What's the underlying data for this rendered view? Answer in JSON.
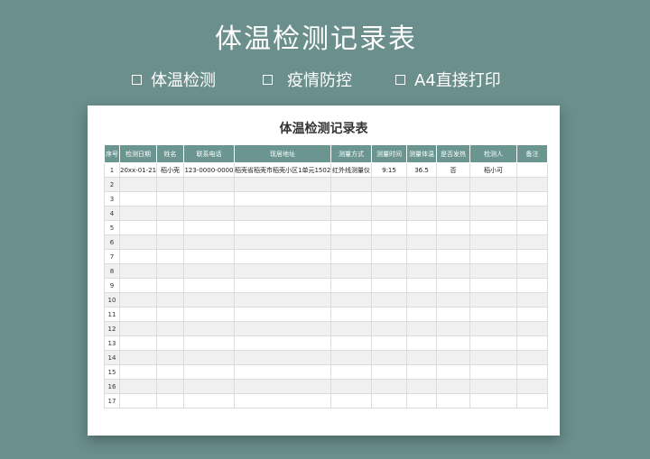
{
  "hero": {
    "title": "体温检测记录表",
    "features": [
      {
        "icon": "checkbox-icon",
        "label": "体温检测"
      },
      {
        "icon": "checkbox-icon",
        "label": "疫情防控"
      },
      {
        "icon": "checkbox-icon",
        "label": "A4直接打印"
      }
    ]
  },
  "sheet": {
    "title": "体温检测记录表",
    "columns": [
      "序号",
      "检测日期",
      "姓名",
      "联系电话",
      "现居地址",
      "测量方式",
      "测量时间",
      "测量体温",
      "是否发热",
      "检测人",
      "备注"
    ],
    "rows": [
      [
        "1",
        "20xx-01-21",
        "稻小壳",
        "123-0000-0000",
        "稻壳省稻壳市稻壳小区1单元1502",
        "红外线测量仪",
        "9:15",
        "36.5",
        "否",
        "稻小可",
        ""
      ],
      [
        "2",
        "",
        "",
        "",
        "",
        "",
        "",
        "",
        "",
        "",
        ""
      ],
      [
        "3",
        "",
        "",
        "",
        "",
        "",
        "",
        "",
        "",
        "",
        ""
      ],
      [
        "4",
        "",
        "",
        "",
        "",
        "",
        "",
        "",
        "",
        "",
        ""
      ],
      [
        "5",
        "",
        "",
        "",
        "",
        "",
        "",
        "",
        "",
        "",
        ""
      ],
      [
        "6",
        "",
        "",
        "",
        "",
        "",
        "",
        "",
        "",
        "",
        ""
      ],
      [
        "7",
        "",
        "",
        "",
        "",
        "",
        "",
        "",
        "",
        "",
        ""
      ],
      [
        "8",
        "",
        "",
        "",
        "",
        "",
        "",
        "",
        "",
        "",
        ""
      ],
      [
        "9",
        "",
        "",
        "",
        "",
        "",
        "",
        "",
        "",
        "",
        ""
      ],
      [
        "10",
        "",
        "",
        "",
        "",
        "",
        "",
        "",
        "",
        "",
        ""
      ],
      [
        "11",
        "",
        "",
        "",
        "",
        "",
        "",
        "",
        "",
        "",
        ""
      ],
      [
        "12",
        "",
        "",
        "",
        "",
        "",
        "",
        "",
        "",
        "",
        ""
      ],
      [
        "13",
        "",
        "",
        "",
        "",
        "",
        "",
        "",
        "",
        "",
        ""
      ],
      [
        "14",
        "",
        "",
        "",
        "",
        "",
        "",
        "",
        "",
        "",
        ""
      ],
      [
        "15",
        "",
        "",
        "",
        "",
        "",
        "",
        "",
        "",
        "",
        ""
      ],
      [
        "16",
        "",
        "",
        "",
        "",
        "",
        "",
        "",
        "",
        "",
        ""
      ],
      [
        "17",
        "",
        "",
        "",
        "",
        "",
        "",
        "",
        "",
        "",
        ""
      ]
    ]
  },
  "colors": {
    "background": "#6a8f8c",
    "header_fill": "#6a9590",
    "zebra_fill": "#f0f0f0"
  }
}
